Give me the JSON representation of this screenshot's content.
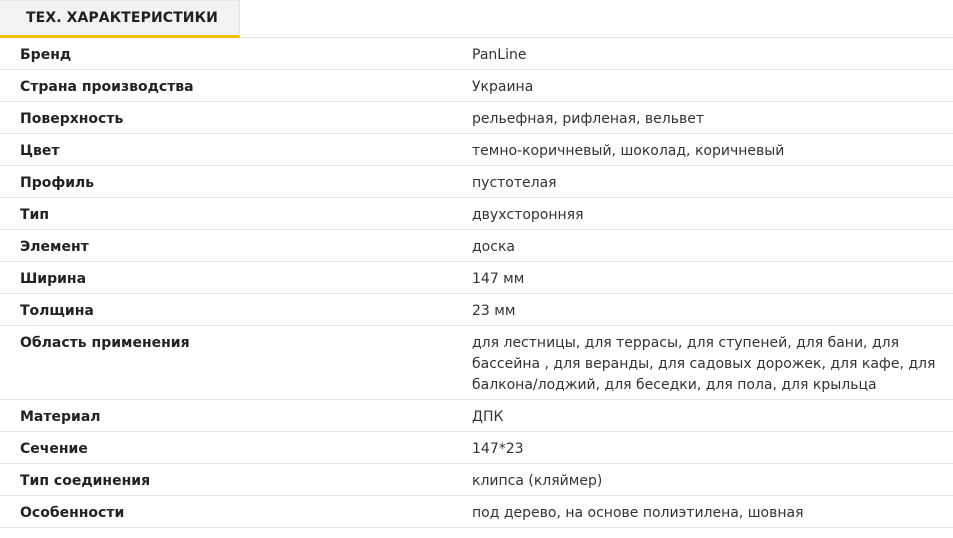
{
  "tab": {
    "label": "ТЕХ. ХАРАКТЕРИСТИКИ"
  },
  "specs": [
    {
      "label": "Бренд",
      "value": "PanLine"
    },
    {
      "label": "Страна производства",
      "value": "Украина"
    },
    {
      "label": "Поверхность",
      "value": "рельефная, рифленая, вельвет"
    },
    {
      "label": "Цвет",
      "value": "темно-коричневый, шоколад, коричневый"
    },
    {
      "label": "Профиль",
      "value": "пустотелая"
    },
    {
      "label": "Тип",
      "value": "двухсторонняя"
    },
    {
      "label": "Элемент",
      "value": "доска"
    },
    {
      "label": "Ширина",
      "value": "147 мм"
    },
    {
      "label": "Толщина",
      "value": "23 мм"
    },
    {
      "label": "Область применения",
      "value": "для лестницы, для террасы, для ступеней, для бани, для бассейна , для веранды, для садовых дорожек, для кафе, для балкона/лоджий, для беседки, для пола, для крыльца"
    },
    {
      "label": "Материал",
      "value": "ДПК"
    },
    {
      "label": "Сечение",
      "value": "147*23"
    },
    {
      "label": "Тип соединения",
      "value": "клипса (кляймер)"
    },
    {
      "label": "Особенности",
      "value": "под дерево, на основе полиэтилена, шовная"
    }
  ],
  "colors": {
    "accent": "#f2c200",
    "tab_background": "#f2f2f2",
    "divider": "#e6e6e6"
  }
}
